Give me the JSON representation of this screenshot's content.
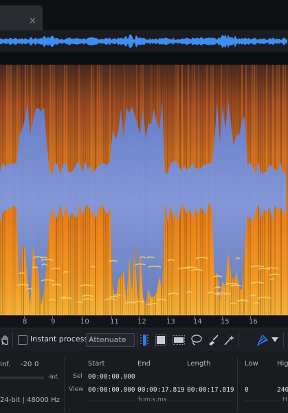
{
  "tab": {
    "close_glyph": "×"
  },
  "timeline": {
    "ticks": [
      "8",
      "9",
      "10",
      "11",
      "12",
      "13",
      "14",
      "15",
      "16"
    ]
  },
  "toolbar": {
    "instant_process_label": "Instant process",
    "mode_value": "Attenuate"
  },
  "meter": {
    "inf_label": "Inf.",
    "minus20_label": "-20",
    "zero_label": "0",
    "neg_inf_label": "-Inf.",
    "format_label": "24-bit | 48000 Hz"
  },
  "selection": {
    "headers": {
      "start": "Start",
      "end": "End",
      "length": "Length"
    },
    "rows": [
      {
        "label": "Sel",
        "start": "00:00:00.000"
      },
      {
        "label": "View",
        "start": "00:00:00.000",
        "end": "00:00:17.819",
        "length": "00:00:17.819"
      }
    ],
    "time_format": "h:m:s.ms"
  },
  "frequency": {
    "low_header": "Low",
    "high_header": "High",
    "low_value": "0",
    "high_value": "240",
    "unit_fragment": "H"
  },
  "colors": {
    "waveform": "#3f8df0",
    "spectro_warm": "#f07a18",
    "spectro_cool": "#6d8fe0",
    "accent_tool": "#2f7cf0"
  }
}
